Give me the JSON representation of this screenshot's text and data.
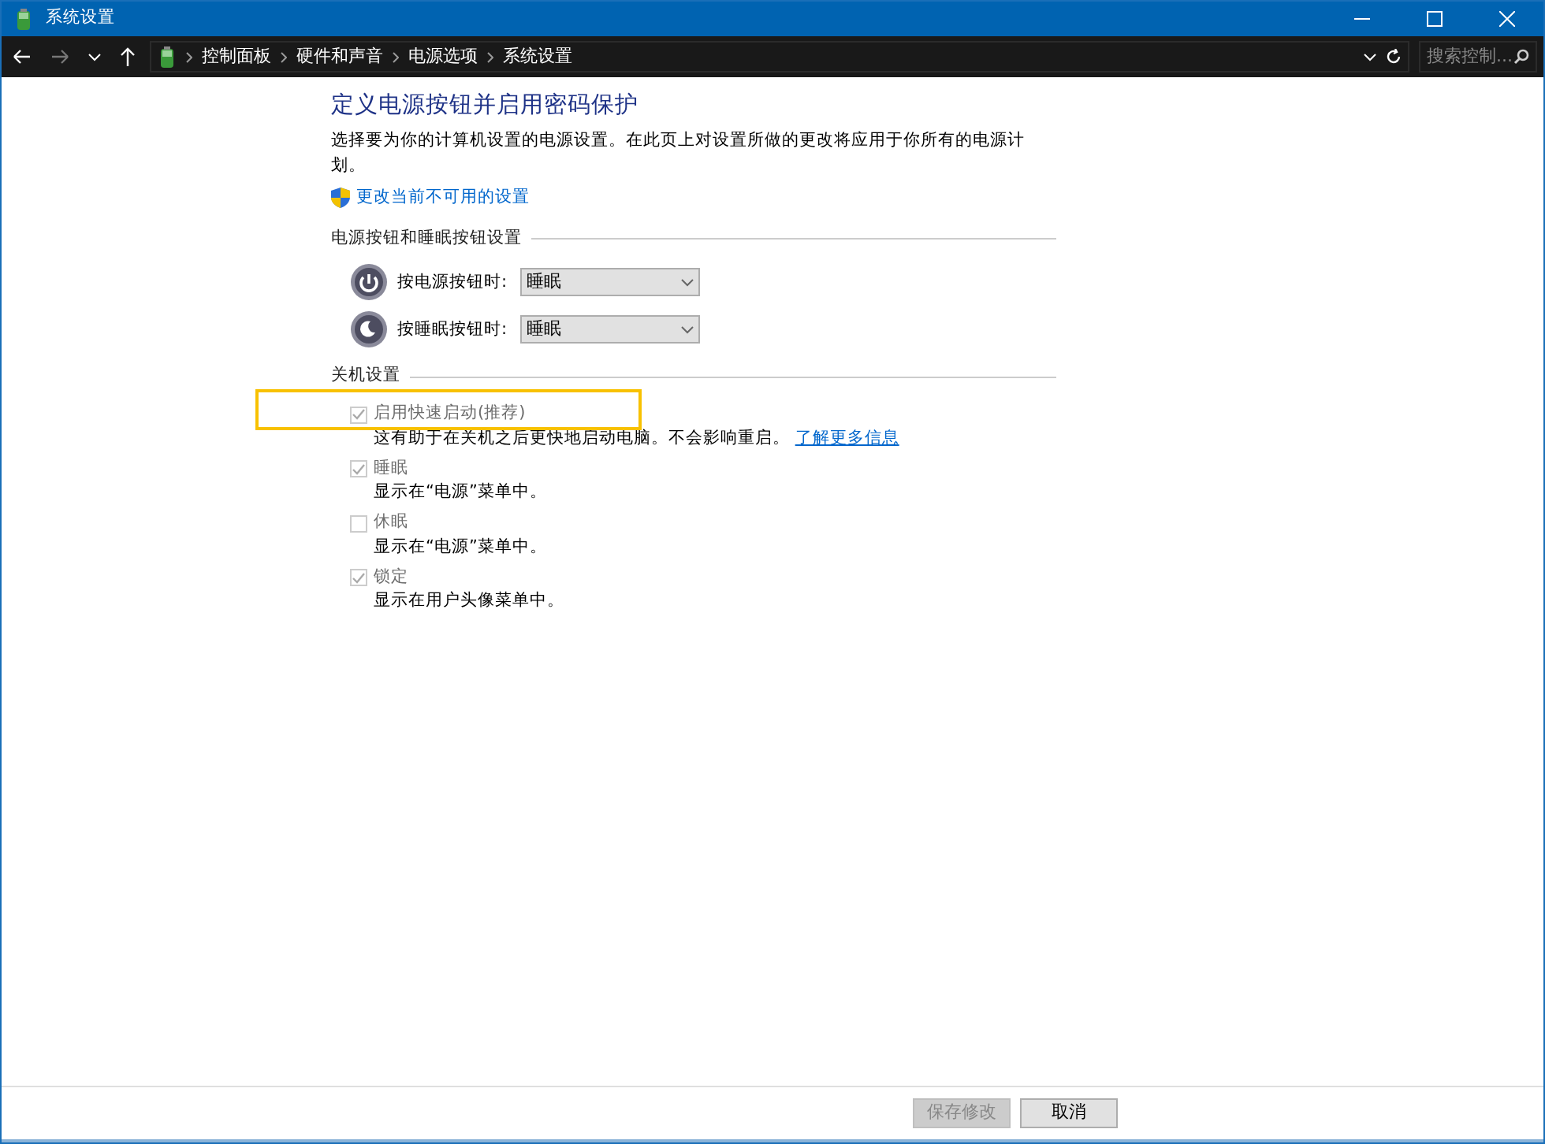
{
  "window": {
    "title": "系统设置"
  },
  "nav": {
    "breadcrumbs": [
      "控制面板",
      "硬件和声音",
      "电源选项",
      "系统设置"
    ],
    "search": {
      "placeholder": "搜索控制..."
    }
  },
  "page": {
    "title": "定义电源按钮并启用密码保护",
    "description": "选择要为你的计算机设置的电源设置。在此页上对设置所做的更改将应用于你所有的电源计划。",
    "admin_link": "更改当前不可用的设置"
  },
  "button_section": {
    "heading": "电源按钮和睡眠按钮设置",
    "rows": [
      {
        "kind": "power",
        "label": "按电源按钮时:",
        "value": "睡眠"
      },
      {
        "kind": "sleep",
        "label": "按睡眠按钮时:",
        "value": "睡眠"
      }
    ]
  },
  "shutdown_section": {
    "heading": "关机设置",
    "items": [
      {
        "label": "启用快速启动(推荐)",
        "checked": true,
        "disabled": true,
        "highlighted": true,
        "description": "这有助于在关机之后更快地启动电脑。不会影响重启。",
        "link": "了解更多信息"
      },
      {
        "label": "睡眠",
        "checked": true,
        "disabled": true,
        "highlighted": false,
        "description": "显示在“电源”菜单中。"
      },
      {
        "label": "休眠",
        "checked": false,
        "disabled": true,
        "highlighted": false,
        "description": "显示在“电源”菜单中。"
      },
      {
        "label": "锁定",
        "checked": true,
        "disabled": true,
        "highlighted": false,
        "description": "显示在用户头像菜单中。"
      }
    ]
  },
  "footer": {
    "buttons": [
      {
        "label": "保存修改",
        "disabled": true
      },
      {
        "label": "取消",
        "disabled": false
      }
    ]
  }
}
